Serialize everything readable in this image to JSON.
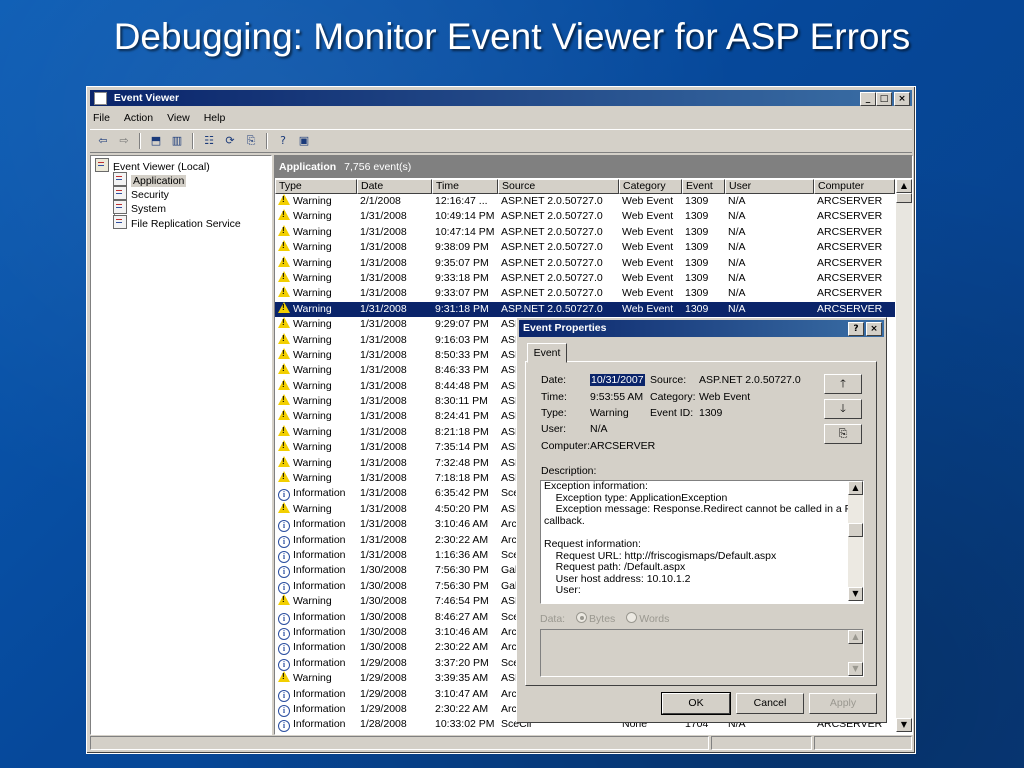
{
  "slide": {
    "title": "Debugging: Monitor Event Viewer for ASP Errors"
  },
  "window": {
    "title": "Event Viewer",
    "menu": [
      "File",
      "Action",
      "View",
      "Help"
    ],
    "toolbar_icons": [
      "back-arrow-icon",
      "forward-arrow-icon",
      "up-folder-icon",
      "show-hide-tree-icon",
      "properties-icon",
      "refresh-icon",
      "export-list-icon",
      "help-icon",
      "console-icon"
    ]
  },
  "tree": {
    "root": "Event Viewer (Local)",
    "items": [
      "Application",
      "Security",
      "System",
      "File Replication Service"
    ],
    "selected": "Application"
  },
  "list": {
    "header_title": "Application",
    "header_count": "7,756 event(s)",
    "columns": [
      "Type",
      "Date",
      "Time",
      "Source",
      "Category",
      "Event",
      "User",
      "Computer"
    ],
    "rows": [
      {
        "type": "Warning",
        "date": "2/1/2008",
        "time": "12:16:47 ...",
        "source": "ASP.NET 2.0.50727.0",
        "category": "Web Event",
        "event": "1309",
        "user": "N/A",
        "computer": "ARCSERVER"
      },
      {
        "type": "Warning",
        "date": "1/31/2008",
        "time": "10:49:14 PM",
        "source": "ASP.NET 2.0.50727.0",
        "category": "Web Event",
        "event": "1309",
        "user": "N/A",
        "computer": "ARCSERVER"
      },
      {
        "type": "Warning",
        "date": "1/31/2008",
        "time": "10:47:14 PM",
        "source": "ASP.NET 2.0.50727.0",
        "category": "Web Event",
        "event": "1309",
        "user": "N/A",
        "computer": "ARCSERVER"
      },
      {
        "type": "Warning",
        "date": "1/31/2008",
        "time": "9:38:09 PM",
        "source": "ASP.NET 2.0.50727.0",
        "category": "Web Event",
        "event": "1309",
        "user": "N/A",
        "computer": "ARCSERVER"
      },
      {
        "type": "Warning",
        "date": "1/31/2008",
        "time": "9:35:07 PM",
        "source": "ASP.NET 2.0.50727.0",
        "category": "Web Event",
        "event": "1309",
        "user": "N/A",
        "computer": "ARCSERVER"
      },
      {
        "type": "Warning",
        "date": "1/31/2008",
        "time": "9:33:18 PM",
        "source": "ASP.NET 2.0.50727.0",
        "category": "Web Event",
        "event": "1309",
        "user": "N/A",
        "computer": "ARCSERVER"
      },
      {
        "type": "Warning",
        "date": "1/31/2008",
        "time": "9:33:07 PM",
        "source": "ASP.NET 2.0.50727.0",
        "category": "Web Event",
        "event": "1309",
        "user": "N/A",
        "computer": "ARCSERVER"
      },
      {
        "type": "Warning",
        "date": "1/31/2008",
        "time": "9:31:18 PM",
        "source": "ASP.NET 2.0.50727.0",
        "category": "Web Event",
        "event": "1309",
        "user": "N/A",
        "computer": "ARCSERVER",
        "selected": true
      },
      {
        "type": "Warning",
        "date": "1/31/2008",
        "time": "9:29:07 PM",
        "source": "ASP",
        "category": "",
        "event": "",
        "user": "",
        "computer": ""
      },
      {
        "type": "Warning",
        "date": "1/31/2008",
        "time": "9:16:03 PM",
        "source": "ASP",
        "category": "",
        "event": "",
        "user": "",
        "computer": ""
      },
      {
        "type": "Warning",
        "date": "1/31/2008",
        "time": "8:50:33 PM",
        "source": "ASP",
        "category": "",
        "event": "",
        "user": "",
        "computer": ""
      },
      {
        "type": "Warning",
        "date": "1/31/2008",
        "time": "8:46:33 PM",
        "source": "ASP",
        "category": "",
        "event": "",
        "user": "",
        "computer": ""
      },
      {
        "type": "Warning",
        "date": "1/31/2008",
        "time": "8:44:48 PM",
        "source": "ASP",
        "category": "",
        "event": "",
        "user": "",
        "computer": ""
      },
      {
        "type": "Warning",
        "date": "1/31/2008",
        "time": "8:30:11 PM",
        "source": "ASP",
        "category": "",
        "event": "",
        "user": "",
        "computer": ""
      },
      {
        "type": "Warning",
        "date": "1/31/2008",
        "time": "8:24:41 PM",
        "source": "ASP",
        "category": "",
        "event": "",
        "user": "",
        "computer": ""
      },
      {
        "type": "Warning",
        "date": "1/31/2008",
        "time": "8:21:18 PM",
        "source": "ASP",
        "category": "",
        "event": "",
        "user": "",
        "computer": ""
      },
      {
        "type": "Warning",
        "date": "1/31/2008",
        "time": "7:35:14 PM",
        "source": "ASP",
        "category": "",
        "event": "",
        "user": "",
        "computer": ""
      },
      {
        "type": "Warning",
        "date": "1/31/2008",
        "time": "7:32:48 PM",
        "source": "ASP",
        "category": "",
        "event": "",
        "user": "",
        "computer": ""
      },
      {
        "type": "Warning",
        "date": "1/31/2008",
        "time": "7:18:18 PM",
        "source": "ASP",
        "category": "",
        "event": "",
        "user": "",
        "computer": ""
      },
      {
        "type": "Information",
        "date": "1/31/2008",
        "time": "6:35:42 PM",
        "source": "Sce",
        "category": "",
        "event": "",
        "user": "",
        "computer": ""
      },
      {
        "type": "Warning",
        "date": "1/31/2008",
        "time": "4:50:20 PM",
        "source": "ASP",
        "category": "",
        "event": "",
        "user": "",
        "computer": ""
      },
      {
        "type": "Information",
        "date": "1/31/2008",
        "time": "3:10:46 AM",
        "source": "ArcS",
        "category": "",
        "event": "",
        "user": "",
        "computer": ""
      },
      {
        "type": "Information",
        "date": "1/31/2008",
        "time": "2:30:22 AM",
        "source": "ArcS",
        "category": "",
        "event": "",
        "user": "",
        "computer": ""
      },
      {
        "type": "Information",
        "date": "1/31/2008",
        "time": "1:16:36 AM",
        "source": "Sce",
        "category": "",
        "event": "",
        "user": "",
        "computer": ""
      },
      {
        "type": "Information",
        "date": "1/30/2008",
        "time": "7:56:30 PM",
        "source": "Gala",
        "category": "",
        "event": "",
        "user": "",
        "computer": ""
      },
      {
        "type": "Information",
        "date": "1/30/2008",
        "time": "7:56:30 PM",
        "source": "Gala",
        "category": "",
        "event": "",
        "user": "",
        "computer": ""
      },
      {
        "type": "Warning",
        "date": "1/30/2008",
        "time": "7:46:54 PM",
        "source": "ASP",
        "category": "",
        "event": "",
        "user": "",
        "computer": ""
      },
      {
        "type": "Information",
        "date": "1/30/2008",
        "time": "8:46:27 AM",
        "source": "Sce",
        "category": "",
        "event": "",
        "user": "",
        "computer": ""
      },
      {
        "type": "Information",
        "date": "1/30/2008",
        "time": "3:10:46 AM",
        "source": "ArcS",
        "category": "",
        "event": "",
        "user": "",
        "computer": ""
      },
      {
        "type": "Information",
        "date": "1/30/2008",
        "time": "2:30:22 AM",
        "source": "ArcS",
        "category": "",
        "event": "",
        "user": "",
        "computer": ""
      },
      {
        "type": "Information",
        "date": "1/29/2008",
        "time": "3:37:20 PM",
        "source": "Sce",
        "category": "",
        "event": "",
        "user": "",
        "computer": ""
      },
      {
        "type": "Warning",
        "date": "1/29/2008",
        "time": "3:39:35 AM",
        "source": "ASP",
        "category": "",
        "event": "",
        "user": "",
        "computer": ""
      },
      {
        "type": "Information",
        "date": "1/29/2008",
        "time": "3:10:47 AM",
        "source": "ArcS",
        "category": "",
        "event": "",
        "user": "",
        "computer": ""
      },
      {
        "type": "Information",
        "date": "1/29/2008",
        "time": "2:30:22 AM",
        "source": "ArcS",
        "category": "",
        "event": "",
        "user": "",
        "computer": ""
      },
      {
        "type": "Information",
        "date": "1/28/2008",
        "time": "10:33:02 PM",
        "source": "SceCli",
        "category": "None",
        "event": "1704",
        "user": "N/A",
        "computer": "ARCSERVER"
      }
    ]
  },
  "dialog": {
    "title": "Event Properties",
    "tab": "Event",
    "date_label": "Date:",
    "date": "10/31/2007",
    "source_label": "Source:",
    "source": "ASP.NET 2.0.50727.0",
    "time_label": "Time:",
    "time": "9:53:55 AM",
    "category_label": "Category:",
    "category": "Web Event",
    "type_label": "Type:",
    "type": "Warning",
    "event_id_label": "Event ID:",
    "event_id": "1309",
    "user_label": "User:",
    "user": "N/A",
    "computer_label": "Computer:",
    "computer": "ARCSERVER",
    "description_label": "Description:",
    "description_lines": [
      "Exception information:",
      "    Exception type: ApplicationException",
      "    Exception message: Response.Redirect cannot be called in a Page",
      "callback.",
      "",
      "Request information:",
      "    Request URL: http://friscogismaps/Default.aspx",
      "    Request path: /Default.aspx",
      "    User host address: 10.10.1.2",
      "    User:"
    ],
    "data_label": "Data:",
    "bytes_label": "Bytes",
    "words_label": "Words",
    "ok_label": "OK",
    "cancel_label": "Cancel",
    "apply_label": "Apply"
  }
}
